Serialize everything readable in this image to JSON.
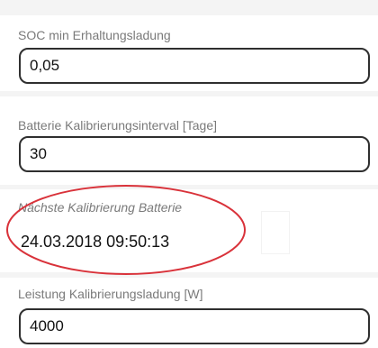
{
  "fields": {
    "soc_min": {
      "label": "SOC min Erhaltungsladung",
      "value": "0,05"
    },
    "calibration_interval": {
      "label": "Batterie Kalibrierungsinterval [Tage]",
      "value": "30"
    },
    "next_calibration": {
      "label": "Nächste Kalibrierung Batterie",
      "value": "24.03.2018 09:50:13"
    },
    "calibration_power": {
      "label": "Leistung Kalibrierungsladung [W]",
      "value": "4000"
    }
  },
  "annotation": {
    "ellipse_color": "#d9323a"
  }
}
